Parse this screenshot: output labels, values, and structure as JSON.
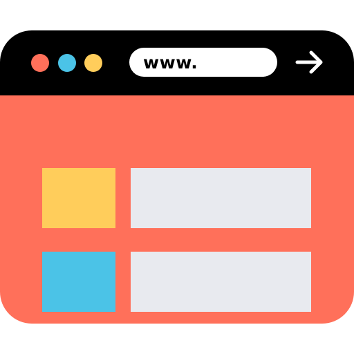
{
  "colors": {
    "titlebar": "#000000",
    "content": "#FF705A",
    "dot_red": "#FF705A",
    "dot_blue": "#4BC3E7",
    "dot_yellow": "#FFCD5B",
    "thumb_yellow": "#FFCD5B",
    "thumb_blue": "#4BC3E7",
    "bar": "#E8EAEF",
    "address_bg": "#FFFFFF"
  },
  "browser": {
    "address_text": "www.",
    "go_icon": "arrow-right-icon"
  },
  "list": {
    "items": [
      {
        "thumb_color": "#FFCD5B"
      },
      {
        "thumb_color": "#4BC3E7"
      }
    ]
  }
}
